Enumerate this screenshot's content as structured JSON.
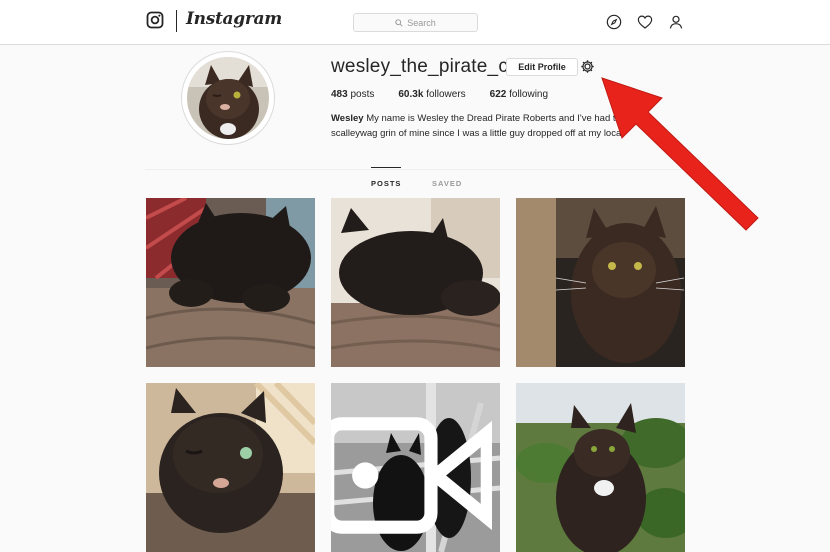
{
  "nav": {
    "logo_text": "Instagram",
    "search_placeholder": "Search",
    "icons": [
      "instagram-glyph-icon",
      "search-icon",
      "compass-icon",
      "heart-icon",
      "user-icon"
    ]
  },
  "profile": {
    "username": "wesley_the_pirate_cat",
    "edit_label": "Edit Profile",
    "stats": [
      {
        "count": "483",
        "label": "posts"
      },
      {
        "count": "60.3k",
        "label": "followers"
      },
      {
        "count": "622",
        "label": "following"
      }
    ],
    "bio_name": "Wesley",
    "bio_line1": " My name is Wesley the Dread Pirate Roberts and I've had this",
    "bio_line2": "scalleywag grin of mine since I was a little guy dropped off at my local"
  },
  "tabs": {
    "posts": "POSTS",
    "saved": "SAVED"
  },
  "posts": [
    {
      "alt": "cat-post-1"
    },
    {
      "alt": "cat-post-2"
    },
    {
      "alt": "cat-post-3"
    },
    {
      "alt": "cat-post-4"
    },
    {
      "alt": "cat-post-5",
      "video": true
    },
    {
      "alt": "cat-post-6"
    }
  ],
  "colors": {
    "arrow": "#e8231c",
    "border": "#dbdbdb",
    "text": "#262626"
  }
}
